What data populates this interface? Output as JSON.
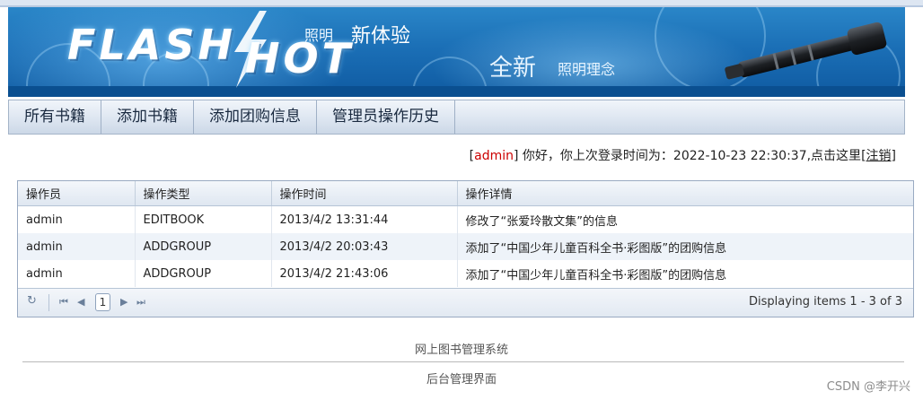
{
  "banner": {
    "logo_line1": "FLASH",
    "logo_line2": "HOT",
    "slogan_small": "照明",
    "slogan_big": "新体验",
    "slogan2_big": "全新",
    "slogan2_small": "照明理念"
  },
  "nav": {
    "items": [
      {
        "label": "所有书籍"
      },
      {
        "label": "添加书籍"
      },
      {
        "label": "添加团购信息"
      },
      {
        "label": "管理员操作历史"
      }
    ]
  },
  "welcome": {
    "bracket_open": "[",
    "user": "admin",
    "bracket_close": "]",
    "message": " 你好，你上次登录时间为：2022-10-23 22:30:37,点击这里",
    "logout_open": "[",
    "logout_label": "注销",
    "logout_close": "]"
  },
  "grid": {
    "columns": [
      "操作员",
      "操作类型",
      "操作时间",
      "操作详情"
    ],
    "rows": [
      [
        "admin",
        "EDITBOOK",
        "2013/4/2 13:31:44",
        "修改了“张爱玲散文集”的信息"
      ],
      [
        "admin",
        "ADDGROUP",
        "2013/4/2 20:03:43",
        "添加了“中国少年儿童百科全书·彩图版”的团购信息"
      ],
      [
        "admin",
        "ADDGROUP",
        "2013/4/2 21:43:06",
        "添加了“中国少年儿童百科全书·彩图版”的团购信息"
      ]
    ],
    "pager": {
      "refresh_icon": "↻",
      "first_icon": "⏮",
      "prev_icon": "◀",
      "page": "1",
      "next_icon": "▶",
      "last_icon": "⏭",
      "info": "Displaying items 1 - 3 of 3"
    }
  },
  "footer": {
    "line1": "网上图书管理系统",
    "line2": "后台管理界面"
  },
  "watermark": "CSDN @李开兴",
  "colors": {
    "banner_blue": "#1b6fb6",
    "user_red": "#cc0000",
    "grid_border": "#99aac2"
  }
}
